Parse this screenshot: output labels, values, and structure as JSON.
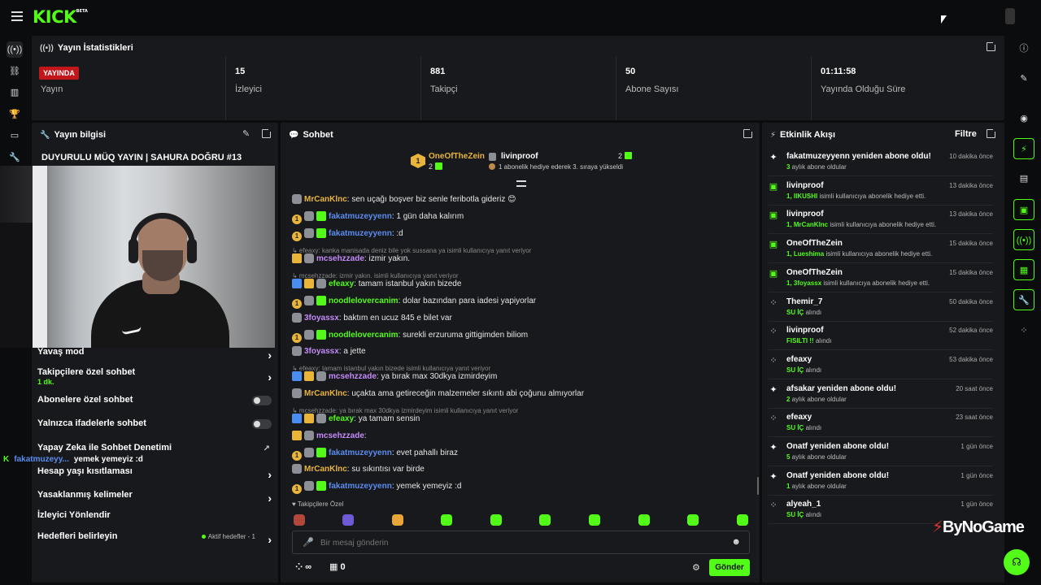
{
  "brand": {
    "logo": "KICK",
    "beta": "BETA",
    "accent": "#53fc18"
  },
  "icons": {
    "menu": "hamburger-icon",
    "popout": "popout-icon",
    "edit": "pencil-icon",
    "info": "info-icon"
  },
  "stats": {
    "title": "Yayın İstatistikleri",
    "items": [
      {
        "badge": "YAYINDA",
        "label": "Yayın"
      },
      {
        "value": "15",
        "label": "İzleyici"
      },
      {
        "value": "881",
        "label": "Takipçi"
      },
      {
        "value": "50",
        "label": "Abone Sayısı"
      },
      {
        "value": "01:11:58",
        "label": "Yayında Olduğu Süre"
      }
    ]
  },
  "info": {
    "title": "Yayın bilgisi",
    "stream_title": "DUYURULU MÜQ YAYIN | SAHURA DOĞRU #13",
    "rows": {
      "slow": "Yavaş mod",
      "followers": "Takipçilere özel sohbet",
      "followers_sub": "1 dk.",
      "subs": "Abonelere özel sohbet",
      "emotes": "Yalnızca ifadelerle sohbet",
      "ai": "Yapay Zeka ile Sohbet Denetimi",
      "age": "Hesap yaşı kısıtlaması",
      "banned": "Yasaklanmış kelimeler",
      "redirect": "İzleyici Yönlendir",
      "goals": "Hedefleri belirleyin",
      "goals_status": "Aktif hedefler - 1"
    },
    "overlay_msg": {
      "user": "fakatmuzeyy...",
      "text": "yemek yemeyiz :d"
    }
  },
  "chat": {
    "title": "Sohbet",
    "pinned": [
      {
        "rank": "1",
        "user": "OneOfTheZein",
        "count": "2"
      },
      {
        "rank": "",
        "user": "livinproof",
        "count": "2",
        "note": "1 abonelik hediye ederek 3. sıraya yükseldi"
      }
    ],
    "messages": [
      {
        "user": "MrCanKlnc",
        "color": "#e8b53a",
        "text": ": sen uçağı boşver biz senle feribotla gideriz 😊"
      },
      {
        "user": "fakatmuzeyyenn",
        "color": "#5b8cf0",
        "text": ": 1 gün daha kalırım"
      },
      {
        "user": "fakatmuzeyyenn",
        "color": "#5b8cf0",
        "text": ": :d"
      },
      {
        "reply": "efeaxy: kanka manisada deniz bile yok sussana ya isimli kullanıcıya yanıt veriyor"
      },
      {
        "user": "mcsehzzade",
        "color": "#c58af9",
        "text": ": izmir yakın."
      },
      {
        "reply": "mcsehzzade: izmir yakın. isimli kullanıcıya yanıt veriyor"
      },
      {
        "user": "efeaxy",
        "color": "#53fc18",
        "text": ": tamam istanbul yakın bizede"
      },
      {
        "user": "noodlelovercanim",
        "color": "#53fc18",
        "text": ": dolar bazından para iadesi yapiyorlar"
      },
      {
        "user": "3foyassx",
        "color": "#c58af9",
        "text": ": baktım en ucuz 845 e bilet var"
      },
      {
        "user": "noodlelovercanim",
        "color": "#53fc18",
        "text": ": surekli erzuruma gittigimden biliom"
      },
      {
        "user": "3foyassx",
        "color": "#c58af9",
        "text": ": a jette"
      },
      {
        "reply": "efeaxy: tamam istanbul yakın bizede isimli kullanıcıya yanıt veriyor"
      },
      {
        "user": "mcsehzzade",
        "color": "#c58af9",
        "text": ": ya bırak max 30dkya izmirdeyim"
      },
      {
        "user": "MrCanKlnc",
        "color": "#e8b53a",
        "text": ": uçakta ama getireceğin malzemeler sıkıntı abi çoğunu almıyorlar"
      },
      {
        "reply": "mcsehzzade: ya bırak max 30dkya izmirdeyim isimli kullanıcıya yanıt veriyor"
      },
      {
        "user": "efeaxy",
        "color": "#53fc18",
        "text": ": ya tamam sensin"
      },
      {
        "user": "mcsehzzade",
        "color": "#c58af9",
        "text": ":"
      },
      {
        "user": "fakatmuzeyyenn",
        "color": "#5b8cf0",
        "text": ": evet pahallı biraz"
      },
      {
        "user": "MrCanKlnc",
        "color": "#e8b53a",
        "text": ": su sıkıntısı var birde"
      },
      {
        "user": "fakatmuzeyyenn",
        "color": "#5b8cf0",
        "text": ": yemek yemeyiz :d"
      }
    ],
    "emote_label": "Takipçilere Özel",
    "input_placeholder": "Bir mesaj gönderin",
    "points": "∞",
    "store_count": "0",
    "send": "Gönder"
  },
  "activity": {
    "title": "Etkinlik Akışı",
    "filter": "Filtre",
    "items": [
      {
        "icon": "sparkle",
        "title": "fakatmuzeyyenn yeniden abone oldu!",
        "g": "3",
        "rest": " aylık abone oldular",
        "time": "10 dakika önce"
      },
      {
        "icon": "gift",
        "title": "livinproof",
        "g": "1, IIKUSHI",
        "rest": " isimli kullanıcıya abonelik hediye etti.",
        "time": "13 dakika önce"
      },
      {
        "icon": "gift",
        "title": "livinproof",
        "g": "1, MrCanKlnc",
        "rest": " isimli kullanıcıya abonelik hediye etti.",
        "time": "13 dakika önce"
      },
      {
        "icon": "gift",
        "title": "OneOfTheZein",
        "g": "1, Lueshima",
        "rest": " isimli kullanıcıya abonelik hediye etti.",
        "time": "15 dakika önce"
      },
      {
        "icon": "gift",
        "title": "OneOfTheZein",
        "g": "1, 3foyassx",
        "rest": " isimli kullanıcıya abonelik hediye etti.",
        "time": "15 dakika önce"
      },
      {
        "icon": "dots",
        "title": "Themir_7",
        "g": "SU İÇ",
        "rest": " alındı",
        "time": "50 dakika önce"
      },
      {
        "icon": "dots",
        "title": "livinproof",
        "g": "FISILTI !!",
        "rest": " alındı",
        "time": "52 dakika önce"
      },
      {
        "icon": "dots",
        "title": "efeaxy",
        "g": "SU İÇ",
        "rest": " alındı",
        "time": "53 dakika önce"
      },
      {
        "icon": "sparkle",
        "title": "afsakar yeniden abone oldu!",
        "g": "2",
        "rest": " aylık abone oldular",
        "time": "20 saat önce"
      },
      {
        "icon": "dots",
        "title": "efeaxy",
        "g": "SU İÇ",
        "rest": " alındı",
        "time": "23 saat önce"
      },
      {
        "icon": "sparkle",
        "title": "Onatf yeniden abone oldu!",
        "g": "5",
        "rest": " aylık abone oldular",
        "time": "1 gün önce"
      },
      {
        "icon": "sparkle",
        "title": "Onatf yeniden abone oldu!",
        "g": "1",
        "rest": " aylık abone oldular",
        "time": "1 gün önce"
      },
      {
        "icon": "dots",
        "title": "alyeah_1",
        "g": "SU İÇ",
        "rest": " alındı",
        "time": "1 gün önce"
      }
    ]
  },
  "watermark": "ByNoGame"
}
